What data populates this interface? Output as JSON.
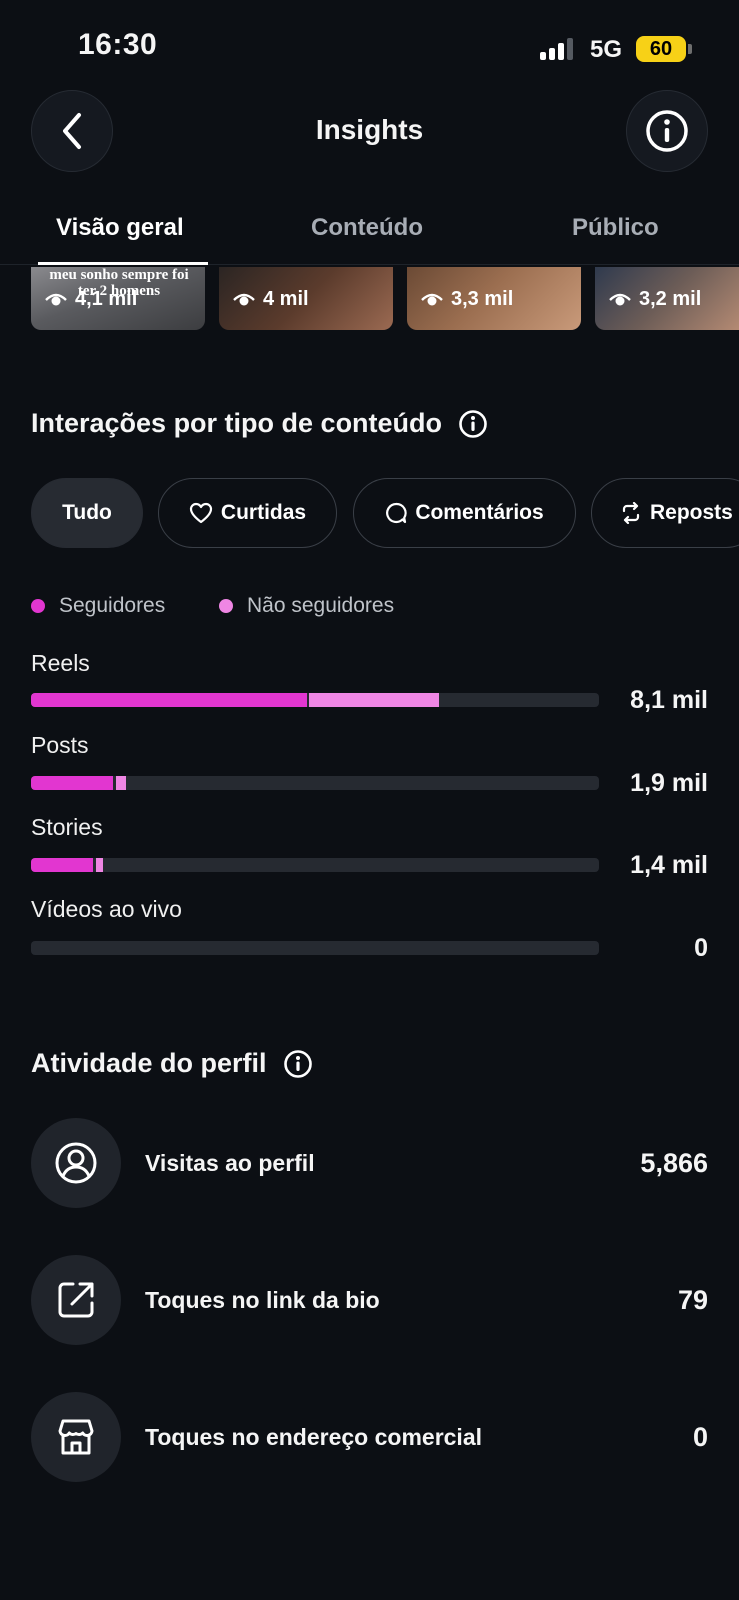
{
  "status_bar": {
    "time": "16:30",
    "network": "5G",
    "battery": "60"
  },
  "header": {
    "title": "Insights"
  },
  "tabs": [
    {
      "label": "Visão geral",
      "active": true
    },
    {
      "label": "Conteúdo",
      "active": false
    },
    {
      "label": "Público",
      "active": false
    }
  ],
  "top_content": [
    {
      "views": "4,1 mil",
      "overlay_text": "meu sonho sempre foi ter 2 homens",
      "icon": "eye-icon"
    },
    {
      "views": "4 mil",
      "icon": "eye-icon"
    },
    {
      "views": "3,3 mil",
      "icon": "eye-icon"
    },
    {
      "views": "3,2 mil",
      "icon": "eye-icon"
    }
  ],
  "interactions": {
    "title": "Interações por tipo de conteúdo",
    "filters": [
      {
        "label": "Tudo",
        "selected": true,
        "icon": ""
      },
      {
        "label": "Curtidas",
        "selected": false,
        "icon": "heart-icon"
      },
      {
        "label": "Comentários",
        "selected": false,
        "icon": "comment-icon"
      },
      {
        "label": "Reposts",
        "selected": false,
        "icon": "repost-icon"
      }
    ],
    "legend": [
      {
        "label": "Seguidores",
        "color": "#e236d0"
      },
      {
        "label": "Não seguidores",
        "color": "#ef86e4"
      }
    ],
    "rows": [
      {
        "label": "Reels",
        "value": "8,1 mil",
        "followers_fraction": 0.486,
        "non_followers_fraction": 0.228
      },
      {
        "label": "Posts",
        "value": "1,9 mil",
        "followers_fraction": 0.145,
        "non_followers_fraction": 0.018
      },
      {
        "label": "Stories",
        "value": "1,4 mil",
        "followers_fraction": 0.11,
        "non_followers_fraction": 0.012
      },
      {
        "label": "Vídeos ao vivo",
        "value": "0",
        "followers_fraction": 0,
        "non_followers_fraction": 0
      }
    ]
  },
  "profile_activity": {
    "title": "Atividade do perfil",
    "items": [
      {
        "label": "Visitas ao perfil",
        "value": "5,866",
        "icon": "profile-icon"
      },
      {
        "label": "Toques no link da bio",
        "value": "79",
        "icon": "external-link-icon"
      },
      {
        "label": "Toques no endereço comercial",
        "value": "0",
        "icon": "storefront-icon"
      }
    ]
  }
}
